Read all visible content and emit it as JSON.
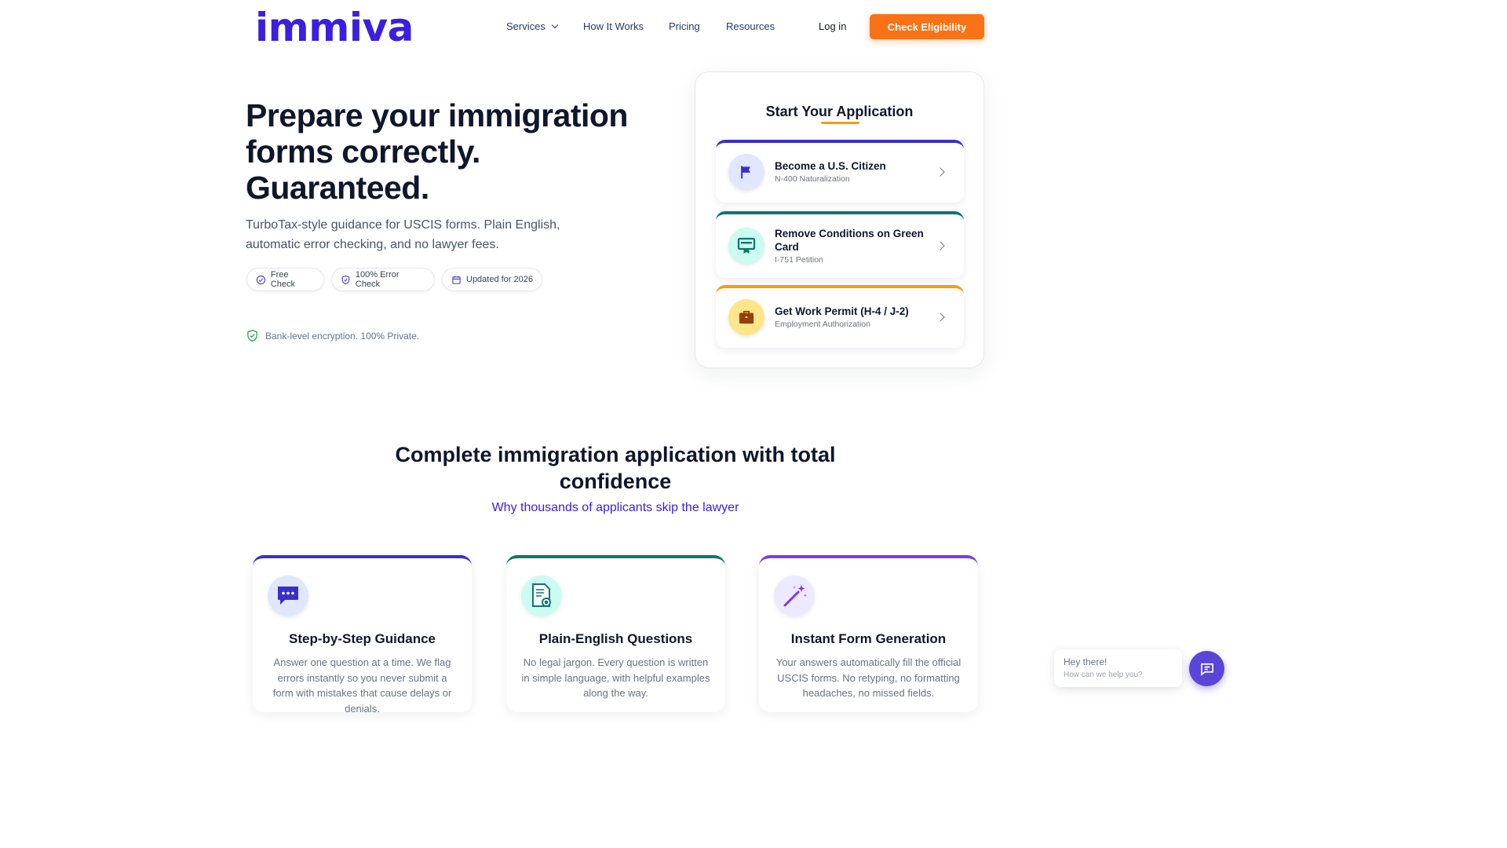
{
  "brand": {
    "logo_text": "immiva",
    "primary_color": "#3b1ee0",
    "accent_color": "#f97316"
  },
  "nav": {
    "services": "Services",
    "how_it_works": "How It Works",
    "pricing": "Pricing",
    "resources": "Resources",
    "login": "Log in",
    "cta": "Check Eligibility"
  },
  "hero": {
    "title_line1": "Prepare your immigration",
    "title_line2": "forms correctly.",
    "title_line3": "Guaranteed.",
    "subtitle": "TurboTax-style guidance for USCIS forms. Plain English, automatic error checking, and no lawyer fees.",
    "badges": [
      {
        "label": "Free Check",
        "icon": "check-circle-icon"
      },
      {
        "label": "100% Error Check",
        "icon": "shield-check-icon"
      },
      {
        "label": "Updated for 2026",
        "icon": "calendar-icon"
      }
    ],
    "security_note": "Bank-level encryption. 100% Private."
  },
  "application": {
    "title": "Start Your Application",
    "options": [
      {
        "name": "Become a U.S. Citizen",
        "sub": "N-400 Naturalization",
        "icon": "flag-icon",
        "color": "#3b2fc9"
      },
      {
        "name": "Remove Conditions on Green Card",
        "sub": "I-751 Petition",
        "icon": "green-card-icon",
        "color": "#0f766e"
      },
      {
        "name": "Get Work Permit (H-4 / J-2)",
        "sub": "Employment Authorization",
        "icon": "briefcase-icon",
        "color": "#f59e0b"
      }
    ]
  },
  "features_section": {
    "title_line1": "Complete immigration application with total",
    "title_line2": "confidence",
    "subtitle": "Why thousands of applicants skip the lawyer",
    "cards": [
      {
        "title": "Step-by-Step Guidance",
        "desc": "Answer one question at a time. We flag errors instantly so you never submit a form with mistakes that cause delays or denials.",
        "icon": "chat-bubble-icon"
      },
      {
        "title": "Plain-English Questions",
        "desc": "No legal jargon. Every question is written in simple language, with helpful examples along the way.",
        "icon": "document-search-icon"
      },
      {
        "title": "Instant Form Generation",
        "desc": "Your answers automatically fill the official USCIS forms. No retyping, no formatting headaches, no missed fields.",
        "icon": "magic-wand-icon"
      }
    ]
  },
  "chat": {
    "greeting": "Hey there!",
    "prompt": "How can we help you?",
    "icon": "chat-icon"
  }
}
